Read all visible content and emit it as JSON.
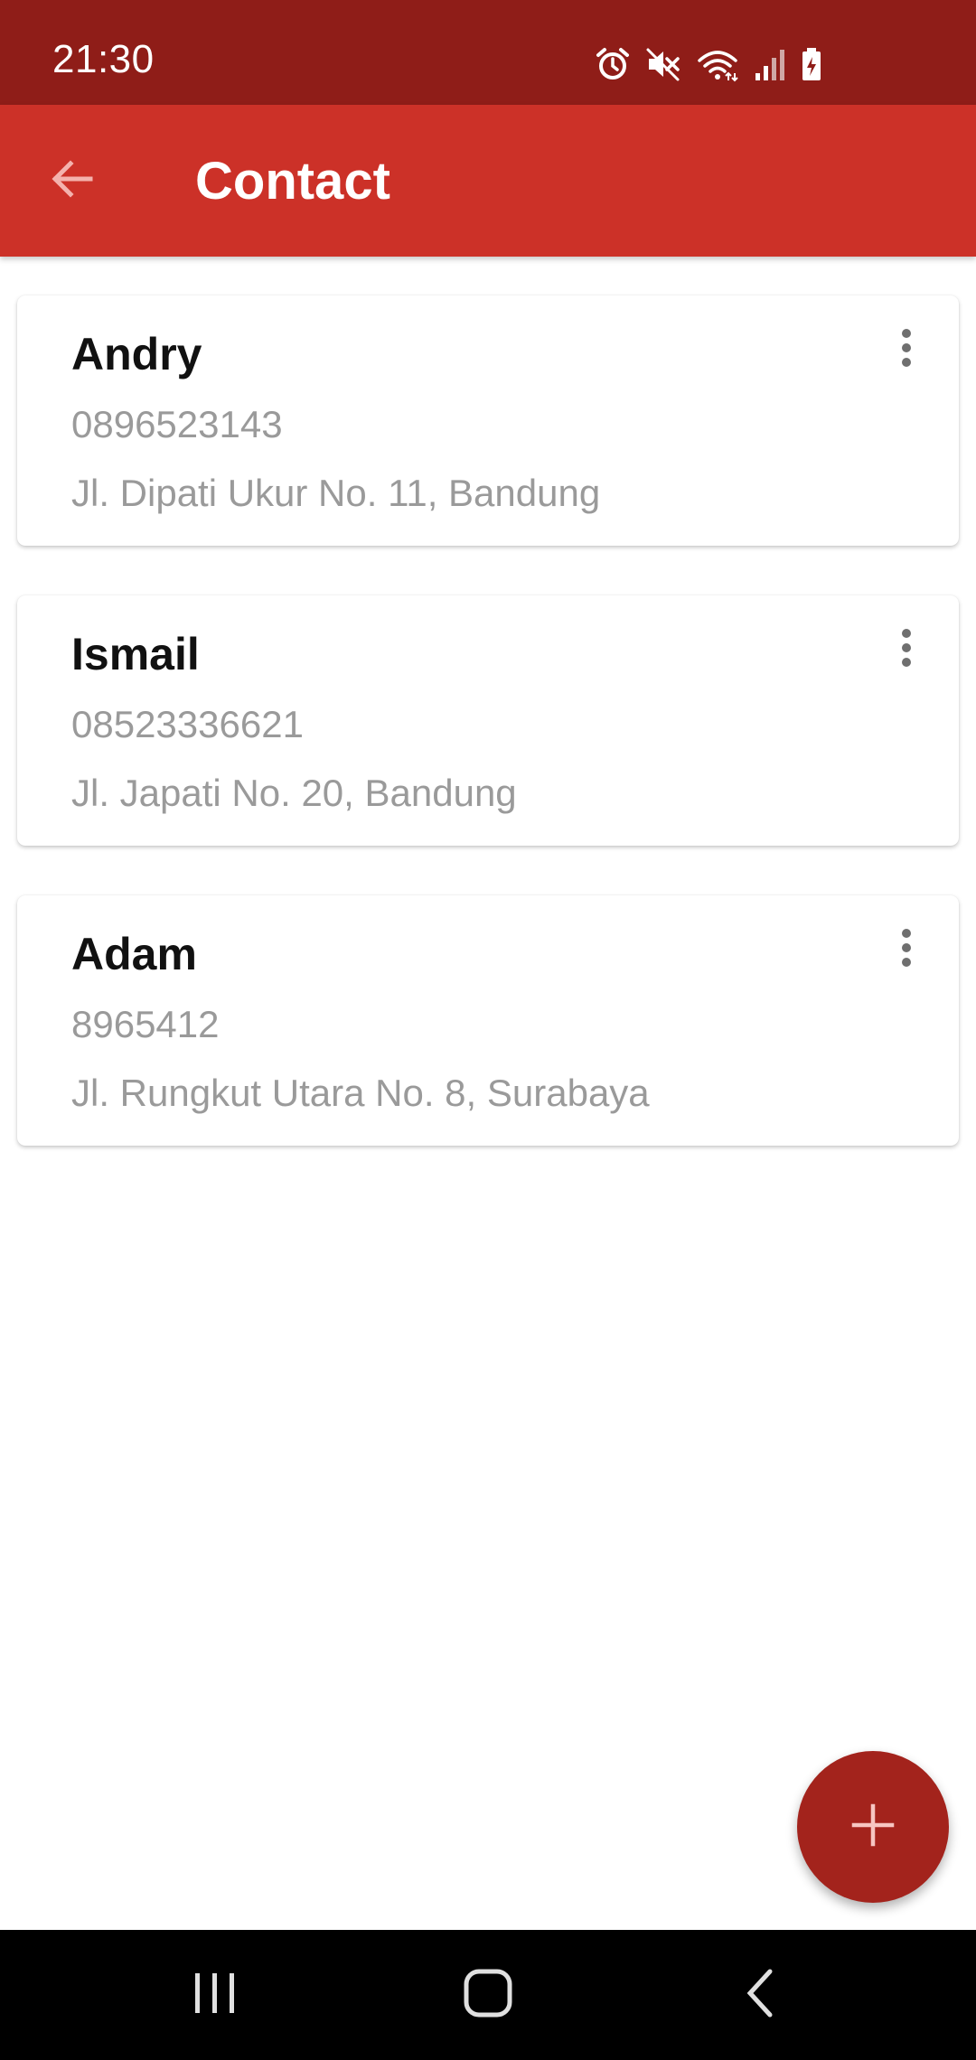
{
  "status_bar": {
    "time": "21:30",
    "icons": [
      "alarm-icon",
      "mute-icon",
      "wifi-icon",
      "signal-icon",
      "battery-charging-icon"
    ]
  },
  "app_bar": {
    "back_icon": "arrow-back-icon",
    "title": "Contact"
  },
  "contacts": [
    {
      "name": "Andry",
      "phone": "0896523143",
      "address": "Jl. Dipati Ukur No. 11, Bandung"
    },
    {
      "name": "Ismail",
      "phone": "08523336621",
      "address": "Jl. Japati No. 20, Bandung"
    },
    {
      "name": "Adam",
      "phone": "8965412",
      "address": "Jl. Rungkut Utara No. 8, Surabaya"
    }
  ],
  "fab": {
    "icon": "plus-icon"
  },
  "nav_bar": {
    "icons": [
      "recent-apps-icon",
      "home-icon",
      "back-icon"
    ]
  },
  "colors": {
    "status_bar": "#8f1d18",
    "app_bar": "#cc3128",
    "fab": "#a3231c",
    "secondary_text": "#9a9a9a"
  }
}
